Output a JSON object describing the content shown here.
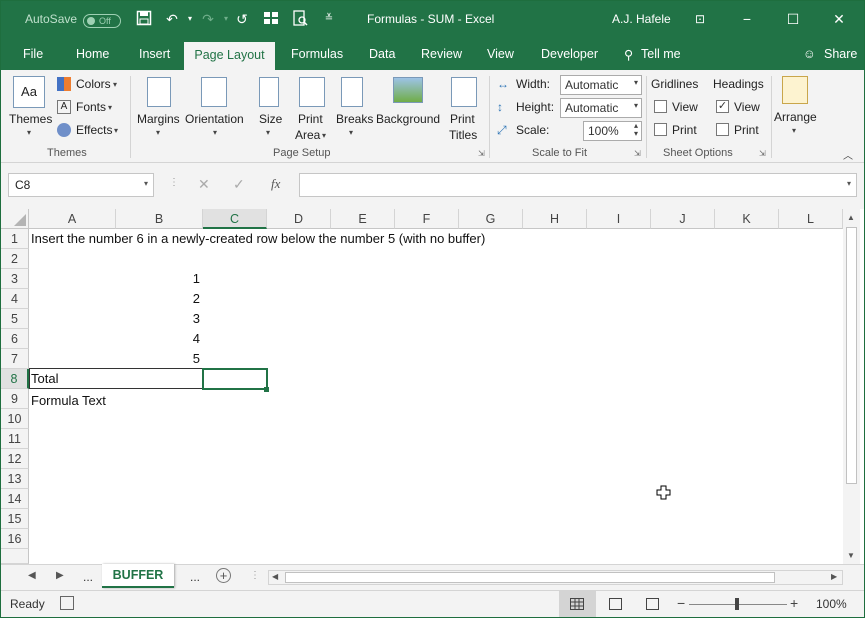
{
  "title_bar": {
    "autosave": "AutoSave",
    "toggle": "Off",
    "doc_title": "Formulas - SUM  -  Excel",
    "user": "A.J. Hafele"
  },
  "menu": {
    "tabs": [
      "File",
      "Home",
      "Insert",
      "Page Layout",
      "Formulas",
      "Data",
      "Review",
      "View",
      "Developer"
    ],
    "tell_me": "Tell me",
    "share": "Share"
  },
  "ribbon": {
    "themes": {
      "themes": "Themes",
      "colors": "Colors",
      "fonts": "Fonts",
      "effects": "Effects",
      "group": "Themes"
    },
    "page_setup": {
      "margins": "Margins",
      "orientation": "Orientation",
      "size": "Size",
      "print_area_1": "Print",
      "print_area_2": "Area",
      "breaks": "Breaks",
      "background": "Background",
      "print_titles_1": "Print",
      "print_titles_2": "Titles",
      "group": "Page Setup"
    },
    "scale": {
      "width_label": "Width:",
      "width_value": "Automatic",
      "height_label": "Height:",
      "height_value": "Automatic",
      "scale_label": "Scale:",
      "scale_value": "100%",
      "group": "Scale to Fit"
    },
    "sheet_options": {
      "gridlines": "Gridlines",
      "headings": "Headings",
      "view": "View",
      "print": "Print",
      "group": "Sheet Options",
      "gridlines_view_checked": false,
      "headings_view_checked": true
    },
    "arrange": {
      "label": "Arrange"
    }
  },
  "formula_bar": {
    "name_box": "C8",
    "formula": ""
  },
  "columns": [
    "A",
    "B",
    "C",
    "D",
    "E",
    "F",
    "G",
    "H",
    "I",
    "J",
    "K",
    "L"
  ],
  "rows": [
    "1",
    "2",
    "3",
    "4",
    "5",
    "6",
    "7",
    "8",
    "9",
    "10",
    "11",
    "12",
    "13",
    "14",
    "15",
    "16"
  ],
  "cells": {
    "a1": "Insert the number 6 in a newly-created row below the number 5 (with no buffer)",
    "b3": "1",
    "b4": "2",
    "b5": "3",
    "b6": "4",
    "b7": "5",
    "a8": "Total",
    "a9": "Formula Text"
  },
  "sheets": {
    "prev_more": "...",
    "active": "BUFFER",
    "next_more": "..."
  },
  "status": {
    "ready": "Ready",
    "zoom": "100%"
  },
  "colors": {
    "accent": "#217346"
  }
}
